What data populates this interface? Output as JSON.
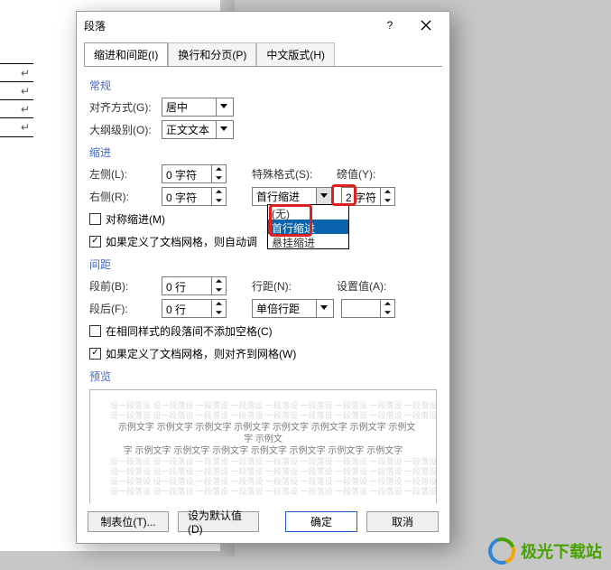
{
  "dialog": {
    "title": "段落",
    "tabs": {
      "t1": "缩进和间距(I)",
      "t2": "换行和分页(P)",
      "t3": "中文版式(H)"
    },
    "section_general": "常规",
    "align_label": "对齐方式(G):",
    "align_value": "居中",
    "outline_label": "大纲级别(O):",
    "outline_value": "正文文本",
    "section_indent": "缩进",
    "left_label": "左侧(L):",
    "left_value": "0 字符",
    "right_label": "右侧(R):",
    "right_value": "0 字符",
    "special_label": "特殊格式(S):",
    "special_value": "首行缩进",
    "special_options": {
      "none": "(无)",
      "firstline": "首行缩进",
      "hanging": "悬挂缩进"
    },
    "by_label": "磅值(Y):",
    "by_value": "2 字符",
    "mirror_label": "对称缩进(M)",
    "autogrid_indent_label": "如果定义了文档网格，则自动调",
    "section_spacing": "间距",
    "before_label": "段前(B):",
    "before_value": "0 行",
    "after_label": "段后(F):",
    "after_value": "0 行",
    "linespacing_label": "行距(N):",
    "linespacing_value": "单倍行距",
    "at_label": "设置值(A):",
    "at_value": "",
    "samestyle_label": "在相同样式的段落间不添加空格(C)",
    "snapgrid_label": "如果定义了文档网格，则对齐到网格(W)",
    "section_preview": "预览",
    "preview_ghost": "设一段落设 设一段落设 一段落设 一段落设 一段落设 一段落设 一段落设 一段落设 一段落设一",
    "preview_sample": "   示例文字 示例文字 示例文字 示例文字 示例文字 示例文字 示例文字 示例文字 示例文\n字 示例文字 示例文字 示例文字 示例文字 示例文字 示例文字 示例文字",
    "btn_tab": "制表位(T)...",
    "btn_default": "设为默认值(D)",
    "btn_ok": "确定",
    "btn_cancel": "取消"
  },
  "doc": {
    "cell_mark": "↵"
  },
  "logo": "极光下载站"
}
